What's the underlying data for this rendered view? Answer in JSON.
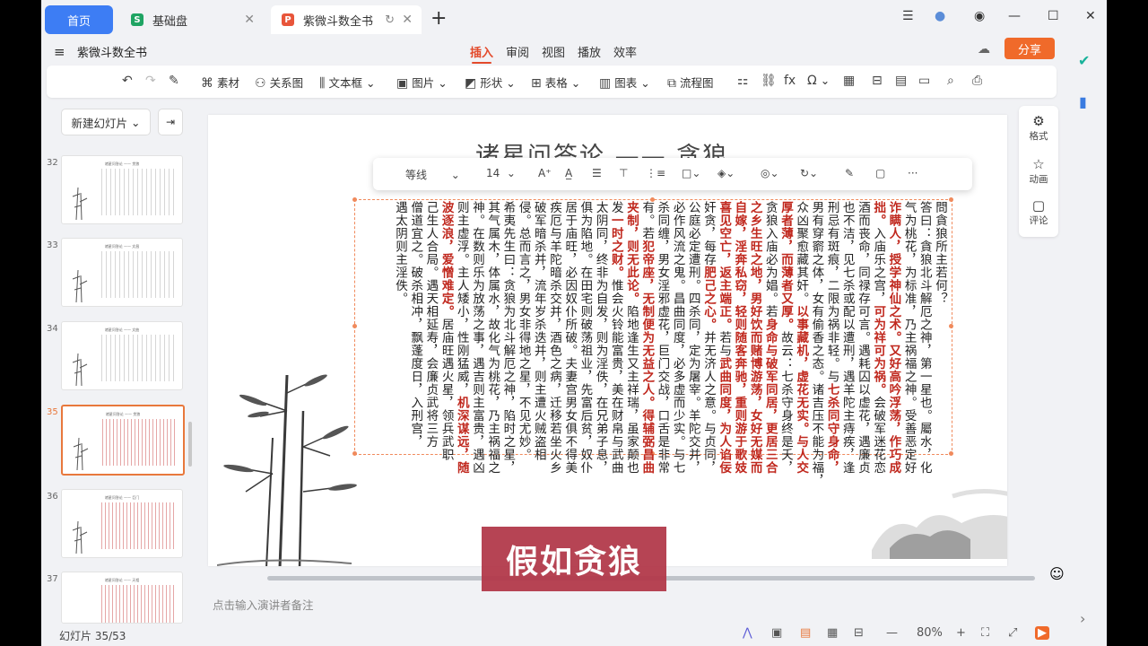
{
  "tabs": {
    "home": "首页",
    "doc1": {
      "label": "基础盘",
      "icon_letter": "S",
      "icon_color": "#1fa463"
    },
    "doc2": {
      "label": "紫微斗数全书",
      "icon_letter": "P",
      "icon_color": "#e8553a"
    }
  },
  "menu": {
    "doc_title": "紫微斗数全书",
    "tabs": [
      "插入",
      "审阅",
      "视图",
      "播放",
      "效率"
    ],
    "active_tab": "插入",
    "share": "分享"
  },
  "ribbon": {
    "items": [
      "素材",
      "关系图",
      "文本框",
      "图片",
      "形状",
      "表格",
      "图表",
      "流程图"
    ]
  },
  "panel": {
    "new_slide": "新建幻灯片",
    "slides": [
      {
        "num": "32",
        "title": "诸星问答论 —— 贪狼"
      },
      {
        "num": "33",
        "title": "诸星问答论 —— 文昌"
      },
      {
        "num": "34",
        "title": "诸星问答论 —— 文曲"
      },
      {
        "num": "35",
        "title": "诸星问答论 —— 贪狼"
      },
      {
        "num": "36",
        "title": "诸星问答论 —— 巨门"
      },
      {
        "num": "37",
        "title": "诸星问答论 —— 天相"
      }
    ]
  },
  "slide": {
    "title": "诸星问答论 —— 贪狼",
    "columns": [
      [
        {
          "t": "問貪狼所主若何？"
        }
      ],
      [
        {
          "t": "答曰：貪狼北斗解厄之神，第一星也。屬水，化"
        }
      ],
      [
        {
          "t": "气为桃花，为标准，乃主祸福之神。受善恶定好"
        }
      ],
      [
        {
          "t": "诈瞒人，授学神仙之术。又好高吟浮荡，作巧成",
          "r": true
        }
      ],
      [
        {
          "t": "拙。",
          "r": true
        },
        {
          "t": "入庙乐之宫，"
        },
        {
          "t": "可为祥可为祸。",
          "r": true
        },
        {
          "t": "会破军迷花恋"
        }
      ],
      [
        {
          "t": "酒而丧命，同禄存可言。遇耗囚以虚花，遇廉贞"
        }
      ],
      [
        {
          "t": "也不洁，见七杀或配以遭刑，遇羊陀主痔疾，逢"
        }
      ],
      [
        {
          "t": "刑忌有斑痕，二限为祸非轻。与"
        },
        {
          "t": "七杀同守身命，",
          "r": true
        }
      ],
      [
        {
          "t": "男有穿窬之体，女有偷香之态。诸吉压不能为福，"
        }
      ],
      [
        {
          "t": "众凶聚愈藏其奸。"
        },
        {
          "t": "以事藏机，虚花无实。与人交",
          "r": true
        }
      ],
      [
        {
          "t": "厚者薄，而薄者又厚。",
          "r": true
        },
        {
          "t": "故云：七杀守身终是夭，"
        }
      ],
      [
        {
          "t": "贪狼入庙必为娼。若"
        },
        {
          "t": "身命与破军同居，更居三合",
          "r": true
        }
      ],
      [
        {
          "t": "之乡生旺之地，男好饮而赌博游荡，女好无媒而",
          "r": true
        }
      ],
      [
        {
          "t": "自嫁，淫奔私窃，轻则随客奔驰，重则游于歌妓",
          "r": true
        }
      ],
      [
        {
          "t": "喜见空亡，返主端正。",
          "r": true
        },
        {
          "t": "若与"
        },
        {
          "t": "武曲同度，为人谄佞",
          "r": true
        }
      ],
      [
        {
          "t": "奸贪，每存"
        },
        {
          "t": "肥己之心。",
          "r": true
        },
        {
          "t": "并无济人之意。与贞同，"
        }
      ],
      [
        {
          "t": "公庭必定遭刑。四杀同，定为屠宰。羊陀交并，"
        }
      ],
      [
        {
          "t": "必作风流之鬼。昌曲同度，必多虚而少实。与七"
        }
      ],
      [
        {
          "t": "杀同缠，男女淫邪虚花，巨门交战，口舌是非常"
        }
      ],
      [
        {
          "t": "有。若"
        },
        {
          "t": "犯帝座，无制便为无益之人。得辅弼昌曲",
          "r": true
        }
      ],
      [
        {
          "t": "夹制，则无此论。",
          "r": true
        },
        {
          "t": "陷地逢生又主祥瑞，虽家颠也"
        }
      ],
      [
        {
          "t": "发"
        },
        {
          "t": "一时之财。",
          "r": true
        },
        {
          "t": "惟会火铃能富贵，美在财帛与武曲"
        }
      ],
      [
        {
          "t": "太阴同，终非为自发，则为淫佚，在兄弟子息，"
        }
      ],
      [
        {
          "t": "俱为陷地。在田宅则破荡祖业，先富后贫，奴仆"
        }
      ],
      [
        {
          "t": "居于庙旺，必因奴仆所破。夫妻宫男女俱不得美"
        }
      ],
      [
        {
          "t": "疾厄与羊陀暗杀交并，酒色之病，迁移若坐火乡"
        }
      ],
      [
        {
          "t": "破军暗杀并，流年岁杀迭并，则主遭火贼盗相"
        }
      ],
      [
        {
          "t": "侵。总而言之，男女非得地之星，不见尤妙。"
        }
      ],
      [
        {
          "t": "希夷先生曰：贪狼为北斗解厄之神，陷时之星，"
        }
      ],
      [
        {
          "t": "其气属木，体属水，故化气为桃花，乃主祸福之"
        }
      ],
      [
        {
          "t": "神。在数则乐为放荡之事，遇吉则主富贵，遇凶"
        }
      ],
      [
        {
          "t": "则主虚浮。主人矮小，性刚猛威，"
        },
        {
          "t": "机深谋远，随",
          "r": true
        }
      ],
      [
        {
          "t": "波逐浪，爱憎难定。",
          "r": true
        },
        {
          "t": "居庙旺遇火星，领兵武职"
        }
      ],
      [
        {
          "t": "己生人合局。遇天相延寿，会廉贞武将三方"
        }
      ],
      [
        {
          "t": "僧道宜之。破杀相冲，飘蓬度日，入刑宫，"
        }
      ],
      [
        {
          "t": "遇太阴则主淫佚。"
        }
      ]
    ]
  },
  "float_toolbar": {
    "font": "等线",
    "size": "14"
  },
  "right_pane": [
    "格式",
    "动画",
    "评论"
  ],
  "notes_placeholder": "点击输入演讲者备注",
  "status": {
    "slide_info": "幻灯片 35/53",
    "zoom": "80%"
  },
  "caption": "假如贪狼"
}
